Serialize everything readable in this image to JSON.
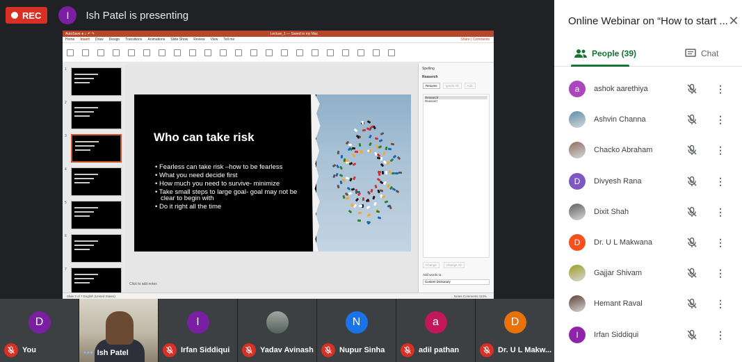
{
  "meeting": {
    "rec_label": "REC",
    "presenter_initial": "I",
    "presenting_text": "Ish Patel is presenting"
  },
  "powerpoint": {
    "titlebar_center": "Lecture_1 — Saved to my Mac",
    "menu": [
      "Home",
      "Insert",
      "Draw",
      "Design",
      "Transitions",
      "Animations",
      "Slide Show",
      "Review",
      "View",
      "Tell me"
    ],
    "active_menu": "Insert",
    "share_label": "Share",
    "comments_label": "Comments",
    "notes_placeholder": "Click to add notes",
    "status_left": "Slide 3 of 7    English (United States)",
    "status_right": "Notes   Comments   113%",
    "spelling_pane": {
      "title": "Spelling",
      "word": "Reaserch",
      "resume_label": "Resume",
      "ignore_label": "Ignore All",
      "add_label": "Add",
      "suggestions": [
        "Research",
        "Reassert"
      ],
      "change_label": "Change",
      "change_all_label": "Change All",
      "add_words_label": "Add words to:",
      "dictionary": "Custom Dictionary"
    },
    "slide": {
      "title": "Who can take risk",
      "bullets": [
        "Fearless can take risk –how to be fearless",
        "What you need decide first",
        "How much you need to survive- minimize",
        "Take small steps to large goal- goal may not be clear to begin with",
        "Do it right all the time"
      ]
    },
    "thumb_numbers": [
      "1",
      "2",
      "3",
      "4",
      "5",
      "6",
      "7"
    ]
  },
  "strip": [
    {
      "initial": "D",
      "name": "You",
      "color": "#7b1fa2",
      "muted": true
    },
    {
      "initial": "",
      "name": "Ish Patel",
      "color": "",
      "muted": false,
      "camera": true
    },
    {
      "initial": "I",
      "name": "Irfan Siddiqui",
      "color": "#7b1fa2",
      "muted": true
    },
    {
      "initial": "",
      "name": "Yadav Avinash",
      "color": "",
      "muted": true,
      "photo": true
    },
    {
      "initial": "N",
      "name": "Nupur Sinha",
      "color": "#1a73e8",
      "muted": true
    },
    {
      "initial": "a",
      "name": "adil pathan",
      "color": "#c2185b",
      "muted": true
    },
    {
      "initial": "D",
      "name": "Dr. U L Makw...",
      "color": "#e8710a",
      "muted": true
    }
  ],
  "panel": {
    "title": "Online Webinar on “How to start ...",
    "people_tab": "People (39)",
    "chat_tab": "Chat",
    "participants": [
      {
        "initial": "a",
        "name": "ashok aarethiya",
        "color": "#ab47bc"
      },
      {
        "initial": "",
        "name": "Ashvin Channa",
        "color": "#5b8fa8",
        "photo": true
      },
      {
        "initial": "",
        "name": "Chacko Abraham",
        "color": "#8d6e63",
        "photo": true
      },
      {
        "initial": "D",
        "name": "Divyesh Rana",
        "color": "#7e57c2"
      },
      {
        "initial": "",
        "name": "Dixit Shah",
        "color": "#616161",
        "photo": true
      },
      {
        "initial": "D",
        "name": "Dr. U L Makwana",
        "color": "#f4511e"
      },
      {
        "initial": "",
        "name": "Gajjar Shivam",
        "color": "#9e9d24",
        "photo": true
      },
      {
        "initial": "",
        "name": "Hemant Raval",
        "color": "#5d4037",
        "photo": true
      },
      {
        "initial": "I",
        "name": "Irfan Siddiqui",
        "color": "#8e24aa"
      }
    ]
  }
}
